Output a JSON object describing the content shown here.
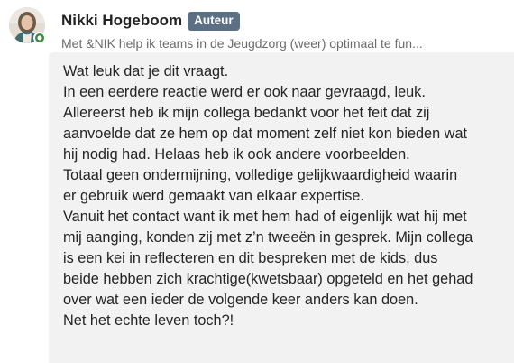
{
  "author": {
    "name": "Nikki Hogeboom",
    "badge": "Auteur",
    "headline": "Met &NIK help ik teams in de Jeugdzorg (weer) optimaal te fun..."
  },
  "colors": {
    "badge_bg": "#5b6f85",
    "bubble_bg": "#f2f2f2",
    "presence": "#3a8a3f",
    "text": "#242424",
    "muted": "#6b6b6b"
  },
  "comment": {
    "lines": [
      "Wat leuk dat je dit vraagt.",
      "In een eerdere reactie werd er ook naar gevraagd, leuk.",
      "Allereerst heb ik mijn collega bedankt voor het feit dat zij",
      "aanvoelde dat ze hem op dat moment zelf niet kon bieden wat",
      "hij nodig had. Helaas heb ik ook andere voorbeelden.",
      "Totaal geen ondermijning, volledige gelijkwaardigheid waarin",
      "er gebruik werd gemaakt van elkaar expertise.",
      "Vanuit het contact want ik met hem had of eigenlijk wat hij met",
      "mij aanging, konden zij met z’n tweeën in gesprek. Mijn collega",
      "is een kei in reflecteren en dit bespreken met de kids, dus",
      "beide hebben zich krachtige(kwetsbaar) opgeteld en het gehad",
      "over wat een ieder de volgende keer anders kan doen.",
      "Net het echte leven toch?!"
    ]
  }
}
